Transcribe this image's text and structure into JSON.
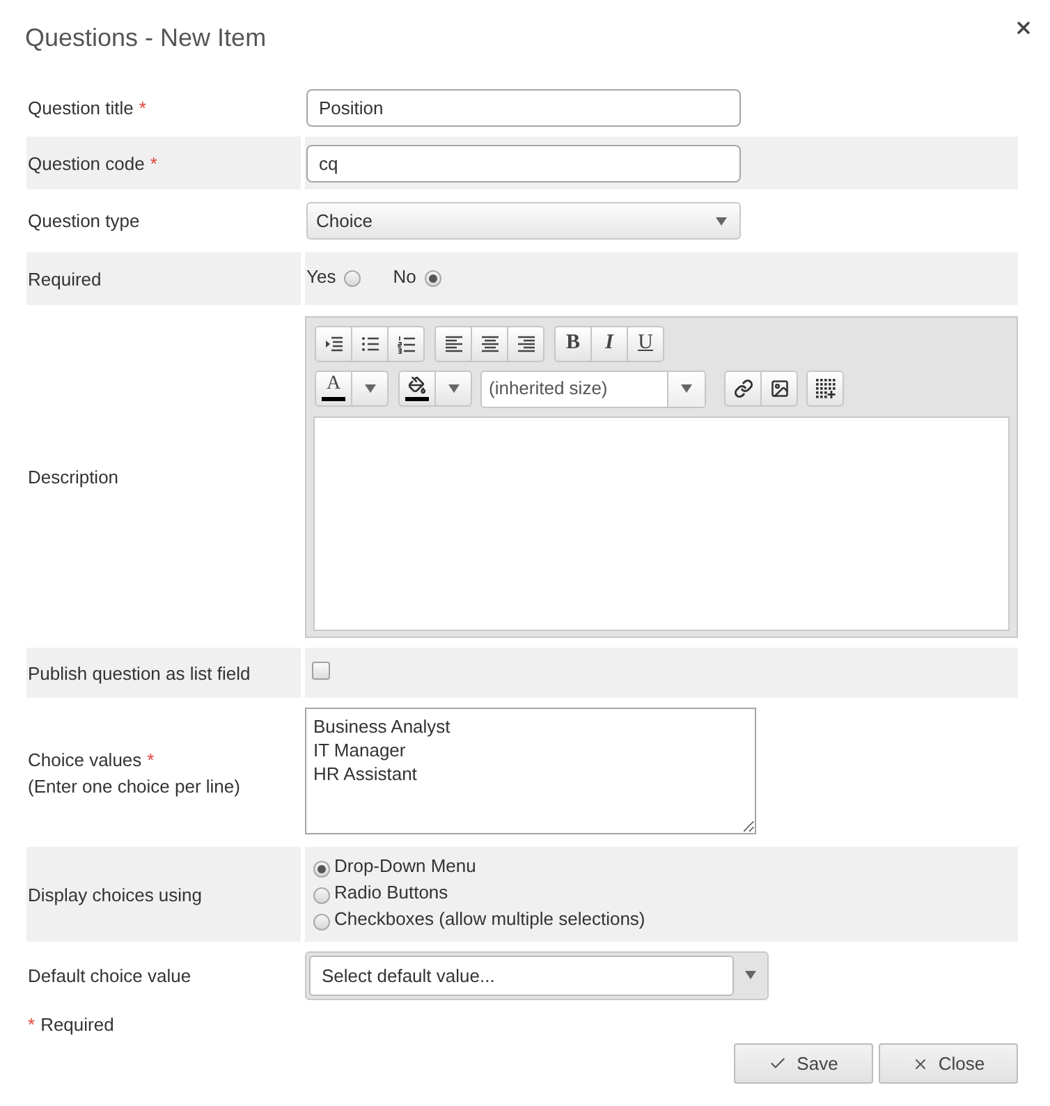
{
  "dialog": {
    "title": "Questions - New Item"
  },
  "fields": [
    {
      "kind": "text",
      "label": "Question title",
      "required_mark": "*",
      "value": "Position"
    },
    {
      "kind": "text",
      "label": "Question code",
      "required_mark": "*",
      "value": "cq"
    },
    {
      "kind": "select",
      "label": "Question type",
      "value": "Choice"
    },
    {
      "kind": "radio",
      "label": "Required",
      "options": [
        {
          "label": "Yes",
          "selected": false
        },
        {
          "label": "No",
          "selected": true
        }
      ]
    },
    {
      "kind": "editor",
      "label": "Description",
      "toolbar": {
        "format_buttons": [
          {
            "kind": "bold",
            "label": "B"
          },
          {
            "kind": "italic",
            "label": "I"
          },
          {
            "kind": "underline",
            "label": "U"
          }
        ],
        "font_color": {
          "label": "A"
        },
        "font_size": {
          "value": "(inherited size)"
        }
      }
    },
    {
      "kind": "checkbox",
      "label": "Publish question as list field",
      "checked": false
    },
    {
      "kind": "textarea",
      "label": "Choice values",
      "required_mark": "*",
      "hint": "(Enter one choice per line)",
      "value": "Business Analyst\nIT Manager\nHR Assistant"
    },
    {
      "kind": "radio_list",
      "label": "Display choices using",
      "options": [
        {
          "label": "Drop-Down Menu",
          "selected": true
        },
        {
          "label": "Radio Buttons",
          "selected": false
        },
        {
          "label": "Checkboxes (allow multiple selections)",
          "selected": false
        }
      ]
    },
    {
      "kind": "combo",
      "label": "Default choice value",
      "placeholder": "Select default value..."
    }
  ],
  "required_note": {
    "mark": "*",
    "text": "Required"
  },
  "buttons": [
    {
      "kind": "save",
      "label": "Save"
    },
    {
      "kind": "close",
      "label": "Close"
    }
  ]
}
